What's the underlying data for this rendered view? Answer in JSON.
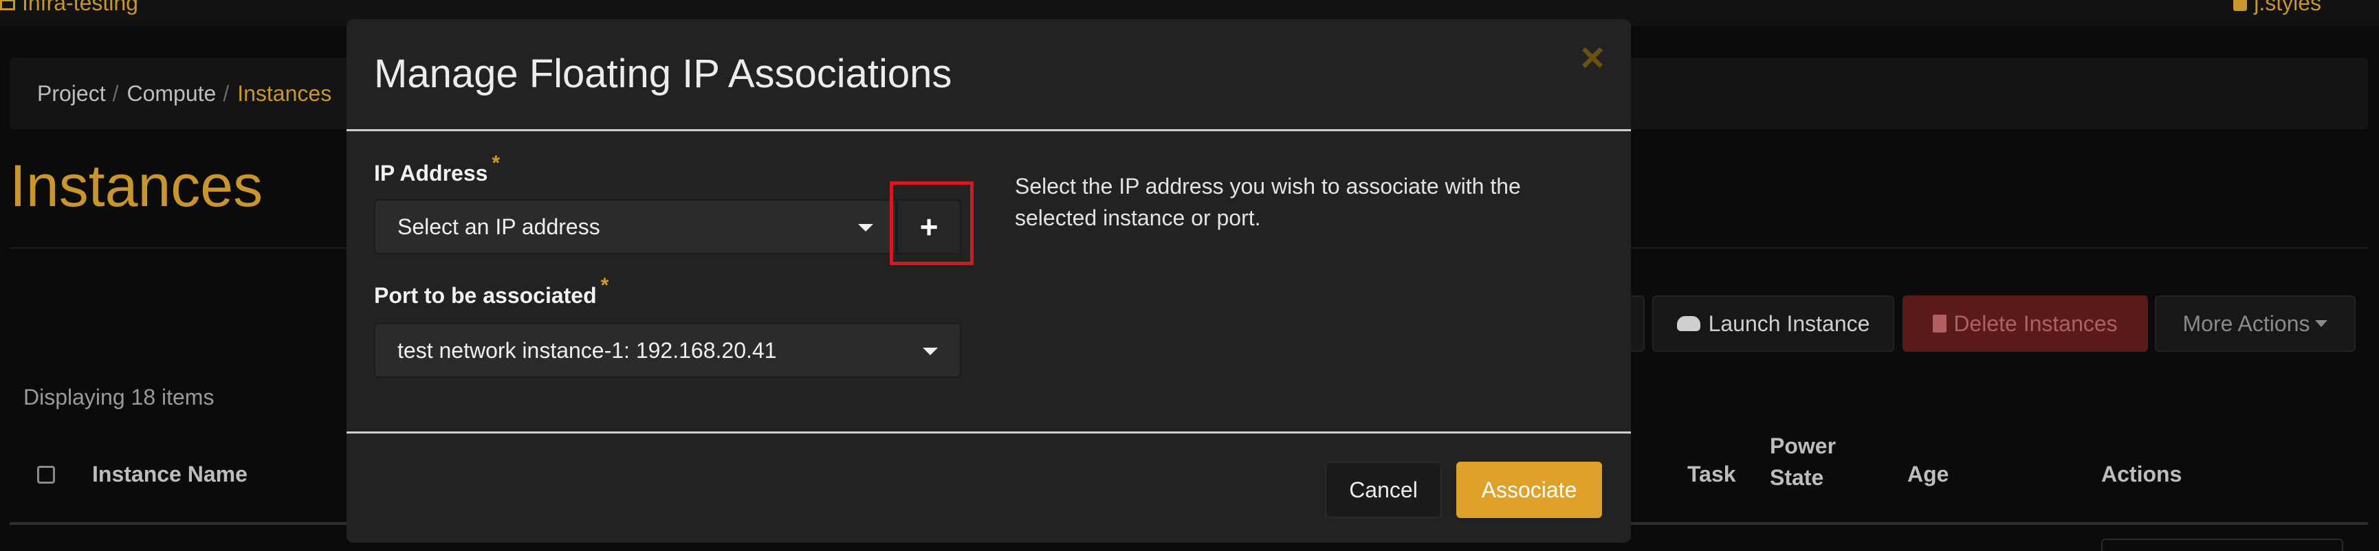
{
  "topbar": {
    "project": "Infra-testing",
    "user": "j.styles"
  },
  "breadcrumb": {
    "items": [
      "Project",
      "Compute"
    ],
    "active": "Instances"
  },
  "page": {
    "title": "Instances",
    "displaying": "Displaying 18 items"
  },
  "actions": {
    "launch": "Launch Instance",
    "delete": "Delete Instances",
    "more": "More Actions"
  },
  "table": {
    "headers": {
      "name": "Instance Name",
      "task": "Task",
      "power_state": "Power State",
      "age": "Age",
      "actions": "Actions"
    }
  },
  "modal": {
    "title": "Manage Floating IP Associations",
    "close_icon": "×",
    "ip_label": "IP Address",
    "required_mark": "*",
    "ip_placeholder": "Select an IP address",
    "add_icon": "+",
    "port_label": "Port to be associated",
    "port_value": "test network instance-1: 192.168.20.41",
    "help": "Select the IP address you wish to associate with the selected instance or port.",
    "cancel": "Cancel",
    "associate": "Associate"
  },
  "colors": {
    "accent": "#c8962a",
    "primary_button": "#e0a12a",
    "highlight": "#d51920",
    "danger": "#5a1a1a"
  }
}
